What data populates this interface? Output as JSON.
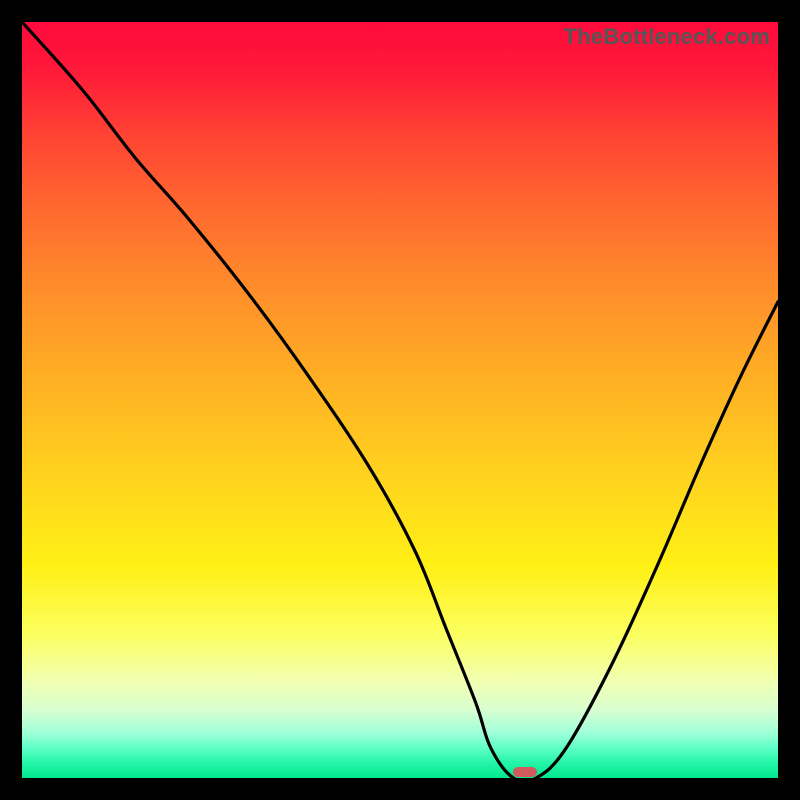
{
  "watermark": "TheBottleneck.com",
  "chart_data": {
    "type": "line",
    "title": "",
    "xlabel": "",
    "ylabel": "",
    "xlim": [
      0,
      100
    ],
    "ylim": [
      0,
      100
    ],
    "grid": false,
    "background": "red-yellow-green vertical gradient",
    "series": [
      {
        "name": "bottleneck-curve",
        "x": [
          0,
          8,
          15,
          22,
          30,
          38,
          46,
          52,
          56,
          60,
          62,
          65,
          68,
          72,
          78,
          84,
          90,
          95,
          100
        ],
        "values": [
          100,
          91,
          82,
          74,
          64,
          53,
          41,
          30,
          20,
          10,
          4,
          0,
          0,
          4,
          15,
          28,
          42,
          53,
          63
        ]
      }
    ],
    "annotations": [
      {
        "name": "optimal-marker",
        "x": 66.5,
        "y": 0.8,
        "color": "#d15a5c"
      }
    ]
  }
}
